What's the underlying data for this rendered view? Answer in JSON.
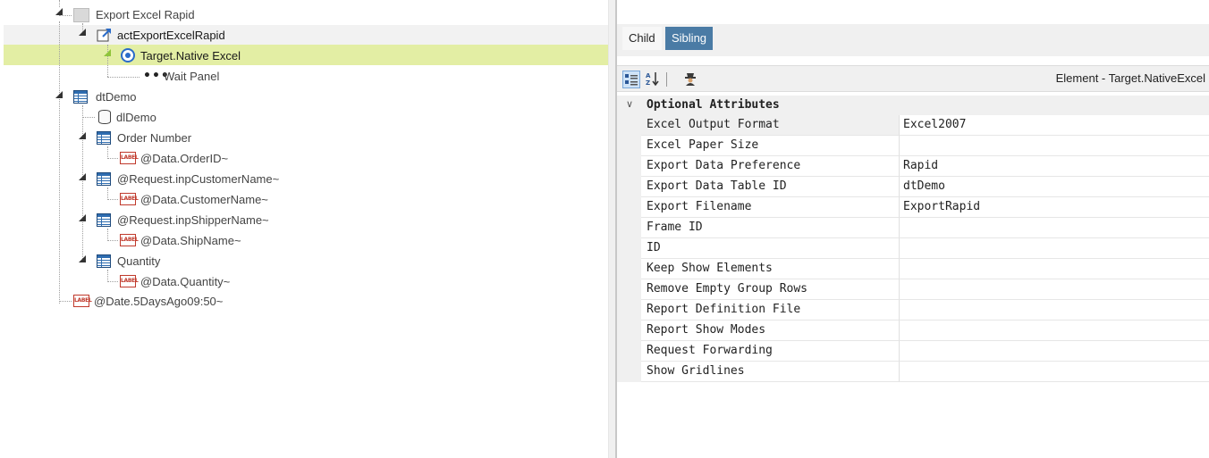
{
  "tree": {
    "nodes": [
      {
        "label": "Export Excel Rapid",
        "icon": "folder-icon"
      },
      {
        "label": "actExportExcelRapid",
        "icon": "action-icon"
      },
      {
        "label": "Target.Native Excel",
        "icon": "target-icon"
      },
      {
        "label": "Wait Panel",
        "icon": "dots-icon"
      },
      {
        "label": "dtDemo",
        "icon": "table-icon"
      },
      {
        "label": "dlDemo",
        "icon": "datalayer-icon"
      },
      {
        "label": "Order Number",
        "icon": "column-icon"
      },
      {
        "label": "@Data.OrderID~",
        "icon": "label-icon"
      },
      {
        "label": "@Request.inpCustomerName~",
        "icon": "column-icon"
      },
      {
        "label": "@Data.CustomerName~",
        "icon": "label-icon"
      },
      {
        "label": "@Request.inpShipperName~",
        "icon": "column-icon"
      },
      {
        "label": "@Data.ShipName~",
        "icon": "label-icon"
      },
      {
        "label": "Quantity",
        "icon": "column-icon"
      },
      {
        "label": "@Data.Quantity~",
        "icon": "label-icon"
      },
      {
        "label": "@Date.5DaysAgo09:50~",
        "icon": "label-icon"
      }
    ],
    "label_icon_text": "LABEL",
    "selection_color": "#e3eea4"
  },
  "tabs": {
    "child": "Child",
    "sibling": "Sibling"
  },
  "toolbar": {
    "element_title": "Element - Target.NativeExcel"
  },
  "properties": {
    "category": "Optional Attributes",
    "rows": [
      {
        "name": "Excel Output Format",
        "value": "Excel2007"
      },
      {
        "name": "Excel Paper Size",
        "value": ""
      },
      {
        "name": "Export Data Preference",
        "value": "Rapid"
      },
      {
        "name": "Export Data Table ID",
        "value": "dtDemo"
      },
      {
        "name": "Export Filename",
        "value": "ExportRapid"
      },
      {
        "name": "Frame ID",
        "value": ""
      },
      {
        "name": "ID",
        "value": ""
      },
      {
        "name": "Keep Show Elements",
        "value": ""
      },
      {
        "name": "Remove Empty Group Rows",
        "value": ""
      },
      {
        "name": "Report Definition File",
        "value": ""
      },
      {
        "name": "Report Show Modes",
        "value": ""
      },
      {
        "name": "Request Forwarding",
        "value": ""
      },
      {
        "name": "Show Gridlines",
        "value": ""
      }
    ]
  }
}
